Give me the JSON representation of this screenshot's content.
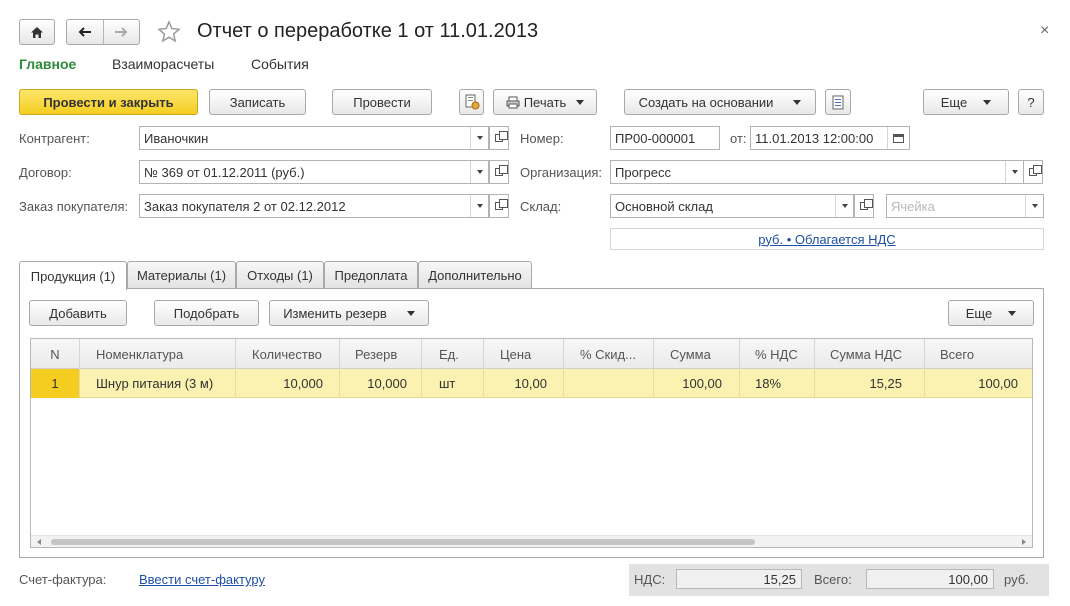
{
  "window": {
    "title": "Отчет о переработке 1 от 11.01.2013",
    "close_icon": "×"
  },
  "sections": [
    "Главное",
    "Взаиморасчеты",
    "События"
  ],
  "toolbar": {
    "post_and_close": "Провести и закрыть",
    "save": "Записать",
    "post": "Провести",
    "print": "Печать",
    "create_based_on": "Создать на основании",
    "more": "Еще",
    "help": "?"
  },
  "form": {
    "counterparty_label": "Контрагент:",
    "counterparty_value": "Иваночкин",
    "contract_label": "Договор:",
    "contract_value": "№ 369 от 01.12.2011 (руб.)",
    "order_label": "Заказ покупателя:",
    "order_value": "Заказ покупателя 2 от 02.12.2012",
    "number_label": "Номер:",
    "number_value": "ПР00-000001",
    "date_label": "от:",
    "date_value": "11.01.2013 12:00:00",
    "organization_label": "Организация:",
    "organization_value": "Прогресс",
    "warehouse_label": "Склад:",
    "warehouse_value": "Основной склад",
    "cell_placeholder": "Ячейка",
    "vat_link": "руб. • Облагается НДС"
  },
  "tabs": [
    "Продукция (1)",
    "Материалы (1)",
    "Отходы (1)",
    "Предоплата",
    "Дополнительно"
  ],
  "table_toolbar": {
    "add": "Добавить",
    "pick": "Подобрать",
    "change_reserve": "Изменить резерв",
    "more": "Еще"
  },
  "table": {
    "columns": [
      "N",
      "Номенклатура",
      "Количество",
      "Резерв",
      "Ед.",
      "Цена",
      "% Скид...",
      "Сумма",
      "% НДС",
      "Сумма НДС",
      "Всего"
    ],
    "rows": [
      [
        "1",
        "Шнур питания (3 м)",
        "10,000",
        "10,000",
        "шт",
        "10,00",
        "",
        "100,00",
        "18%",
        "15,25",
        "100,00"
      ]
    ]
  },
  "footer": {
    "invoice_label": "Счет-фактура:",
    "invoice_link": "Ввести счет-фактуру",
    "vat_label": "НДС:",
    "vat_value": "15,25",
    "total_label": "Всего:",
    "total_value": "100,00",
    "currency": "руб."
  },
  "colors": {
    "accent_green": "#2e8b3a",
    "primary_button": "#f5cd21",
    "selected_row": "#fbf1b0",
    "link": "#1f4fa5"
  }
}
